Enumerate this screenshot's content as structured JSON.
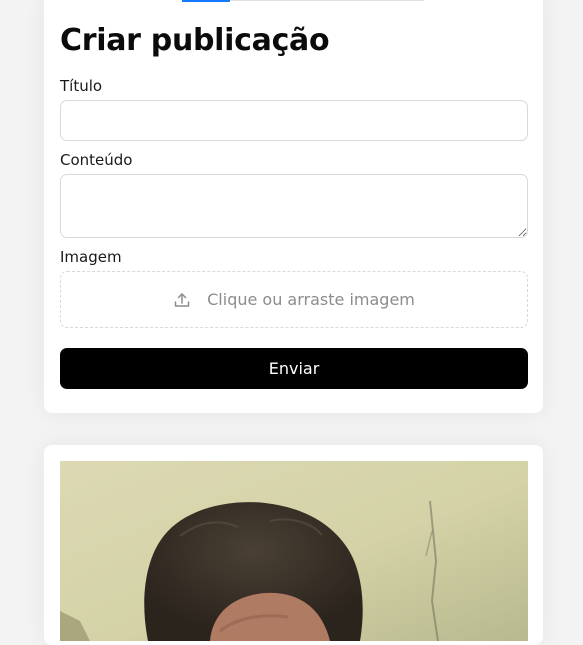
{
  "create_post": {
    "title": "Criar publicação",
    "fields": {
      "title_label": "Título",
      "title_value": "",
      "content_label": "Conteúdo",
      "content_value": "",
      "image_label": "Imagem",
      "upload_text": "Clique ou arraste imagem"
    },
    "submit_label": "Enviar"
  },
  "post": {
    "image": {
      "kind": "photo",
      "description_icon": "photo-of-person"
    }
  },
  "colors": {
    "accent": "#1677ff",
    "button_bg": "#000000",
    "button_text": "#ffffff",
    "placeholder": "#8c8c8c"
  },
  "icons": {
    "upload": "upload-icon"
  }
}
